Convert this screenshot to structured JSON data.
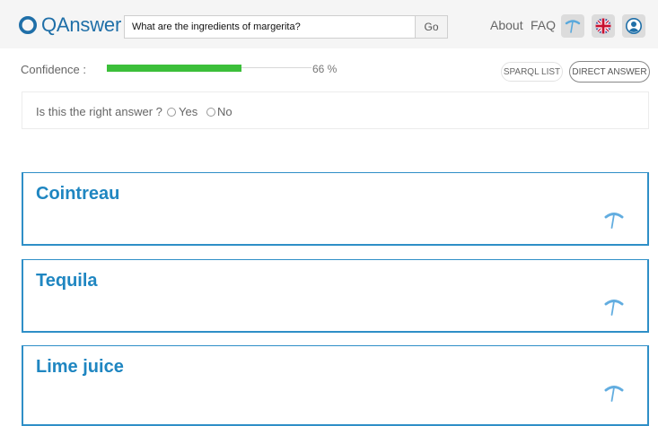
{
  "header": {
    "brand": "QAnswer",
    "search_value": "What are the ingredients of margerita?",
    "go_label": "Go",
    "nav": {
      "about": "About",
      "faq": "FAQ"
    },
    "icons": [
      "pickaxe-icon",
      "uk-flag-icon",
      "user-icon"
    ]
  },
  "confidence": {
    "label": "Confidence :",
    "percent": 66,
    "percent_text": "66 %"
  },
  "actions": {
    "sparql_list": "SPARQL LIST",
    "direct_answer": "DIRECT ANSWER"
  },
  "feedback": {
    "question": "Is this the right answer ?",
    "yes": "Yes",
    "no": "No"
  },
  "answers": [
    {
      "title": "Cointreau"
    },
    {
      "title": "Tequila"
    },
    {
      "title": "Lime juice"
    }
  ],
  "colors": {
    "brand_blue": "#1f86c1",
    "confidence_green": "#3cbf3a",
    "border_blue": "#2f8fc7"
  }
}
